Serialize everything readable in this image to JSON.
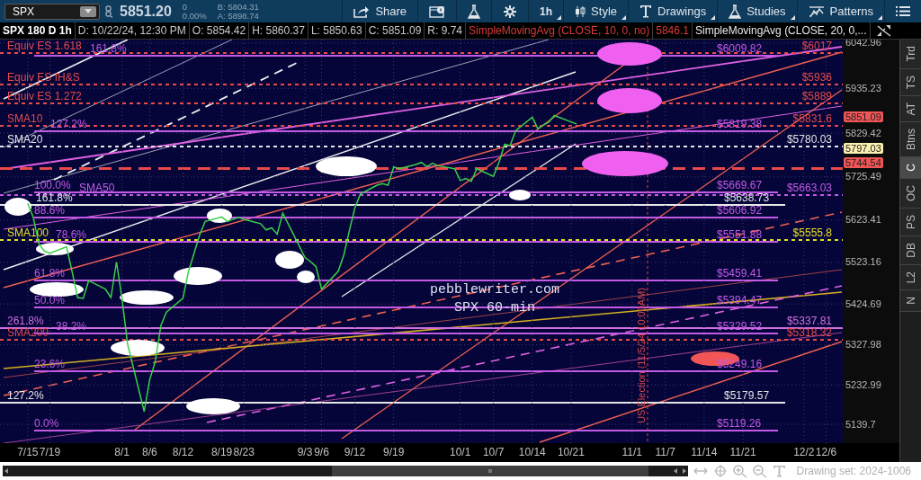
{
  "symbol_field": {
    "value": "SPX"
  },
  "quote": {
    "last": "5851.20",
    "change": "0",
    "change_pct": "0.00%",
    "bid": "B: 5804.31",
    "ask": "A: 5898.74"
  },
  "toolbar": [
    {
      "kind": "share",
      "label": "Share",
      "dropdown": false
    },
    {
      "kind": "info",
      "dropdown": false
    },
    {
      "kind": "flask",
      "dropdown": false
    },
    {
      "kind": "gear",
      "dropdown": false
    },
    {
      "kind": "text",
      "label": "1h",
      "dropdown": true
    },
    {
      "kind": "candles",
      "label": "Style",
      "dropdown": true
    },
    {
      "kind": "letter",
      "label": "Drawings",
      "dropdown": true
    },
    {
      "kind": "flask",
      "label": "Studies",
      "dropdown": true
    },
    {
      "kind": "pattern",
      "label": "Patterns",
      "dropdown": true
    },
    {
      "kind": "list",
      "dropdown": false
    }
  ],
  "info_bar": [
    {
      "kind": "plain",
      "text": "D: 10/22/24, 12:30 PM"
    },
    {
      "kind": "plain",
      "text": "O: 5854.42"
    },
    {
      "kind": "plain",
      "text": "H: 5860.37"
    },
    {
      "kind": "plain",
      "text": "L: 5850.63"
    },
    {
      "kind": "plain",
      "text": "C: 5851.09"
    },
    {
      "kind": "plain",
      "text": "R: 9.74"
    },
    {
      "kind": "study_red",
      "text": "SimpleMovingAvg (CLOSE, 10, 0, no)"
    },
    {
      "kind": "study_red",
      "text": "5846.1"
    },
    {
      "kind": "study",
      "text": "SimpleMovingAvg (CLOSE, 20, 0,..."
    }
  ],
  "chart": {
    "chart_data": {
      "type": "line",
      "grid": true,
      "x": [
        "2024-07-15",
        "2024-07-16",
        "2024-07-17",
        "2024-07-18",
        "2024-07-19",
        "2024-07-22",
        "2024-07-23",
        "2024-07-24",
        "2024-07-25",
        "2024-07-26",
        "2024-07-29",
        "2024-07-30",
        "2024-07-31",
        "2024-08-01",
        "2024-08-02",
        "2024-08-05",
        "2024-08-06",
        "2024-08-07",
        "2024-08-08",
        "2024-08-09",
        "2024-08-12",
        "2024-08-13",
        "2024-08-14",
        "2024-08-15",
        "2024-08-16",
        "2024-08-19",
        "2024-08-20",
        "2024-08-21",
        "2024-08-22",
        "2024-08-23",
        "2024-08-26",
        "2024-08-27",
        "2024-08-28",
        "2024-08-29",
        "2024-08-30",
        "2024-09-03",
        "2024-09-04",
        "2024-09-05",
        "2024-09-06",
        "2024-09-09",
        "2024-09-10",
        "2024-09-11",
        "2024-09-12",
        "2024-09-13",
        "2024-09-16",
        "2024-09-17",
        "2024-09-18",
        "2024-09-19",
        "2024-09-20",
        "2024-09-23",
        "2024-09-24",
        "2024-09-25",
        "2024-09-26",
        "2024-09-27",
        "2024-09-30",
        "2024-10-01",
        "2024-10-02",
        "2024-10-03",
        "2024-10-04",
        "2024-10-07",
        "2024-10-08",
        "2024-10-09",
        "2024-10-10",
        "2024-10-11",
        "2024-10-14",
        "2024-10-15",
        "2024-10-16",
        "2024-10-17",
        "2024-10-18",
        "2024-10-21",
        "2024-10-22"
      ],
      "series": [
        {
          "name": "SPX 180 D 1h",
          "color": "#3ad04a",
          "values": [
            5663,
            5630,
            5567,
            5550,
            5545,
            5560,
            5502,
            5440,
            5438,
            5480,
            5460,
            5440,
            5524,
            5438,
            5330,
            5170,
            5245,
            5288,
            5373,
            5405,
            5438,
            5502,
            5545,
            5588,
            5620,
            5631,
            5620,
            5625,
            5630,
            5625,
            5615,
            5600,
            5605,
            5590,
            5640,
            5535,
            5525,
            5513,
            5460,
            5502,
            5540,
            5598,
            5652,
            5685,
            5706,
            5710,
            5706,
            5749,
            5745,
            5755,
            5760,
            5750,
            5758,
            5752,
            5745,
            5717,
            5722,
            5715,
            5745,
            5727,
            5760,
            5803,
            5800,
            5835,
            5867,
            5840,
            5848,
            5856,
            5871,
            5856,
            5851
          ]
        }
      ],
      "xlim": [
        "2024-07-10",
        "2024-12-09"
      ],
      "ylim": [
        5095,
        6051
      ],
      "xticks": [
        {
          "value": "2024-07-15",
          "label": "7/15"
        },
        {
          "value": "2024-07-19",
          "label": "7/19"
        },
        {
          "value": "2024-08-01",
          "label": "8/1"
        },
        {
          "value": "2024-08-06",
          "label": "8/6"
        },
        {
          "value": "2024-08-12",
          "label": "8/12"
        },
        {
          "value": "2024-08-19",
          "label": "8/19"
        },
        {
          "value": "2024-08-23",
          "label": "8/23"
        },
        {
          "value": "2024-09-03",
          "label": "9/3"
        },
        {
          "value": "2024-09-06",
          "label": "9/6"
        },
        {
          "value": "2024-09-12",
          "label": "9/12"
        },
        {
          "value": "2024-09-19",
          "label": "9/19"
        },
        {
          "value": "2024-10-01",
          "label": "10/1"
        },
        {
          "value": "2024-10-07",
          "label": "10/7"
        },
        {
          "value": "2024-10-14",
          "label": "10/14"
        },
        {
          "value": "2024-10-21",
          "label": "10/21"
        },
        {
          "value": "2024-11-01",
          "label": "11/1"
        },
        {
          "value": "2024-11-07",
          "label": "11/7"
        },
        {
          "value": "2024-11-14",
          "label": "11/14"
        },
        {
          "value": "2024-11-21",
          "label": "11/21"
        },
        {
          "value": "2024-12-02",
          "label": "12/2"
        },
        {
          "value": "2024-12-06",
          "label": "12/6"
        }
      ],
      "yticks": [
        6042.96,
        5935.23,
        5829.42,
        5725.49,
        5623.41,
        5523.16,
        5424.69,
        5327.98,
        5232.99,
        5139.7
      ]
    }
  },
  "drawings": {
    "levels": [
      {
        "kind": "average",
        "name": "Equiv ES 1.618",
        "label": "$6017",
        "color": "#e84a4a"
      },
      {
        "kind": "fib",
        "name": "161.8%",
        "label": "$6009.82",
        "color": "#c25ae6"
      },
      {
        "kind": "average",
        "name": "Equiv ES IH&S",
        "label": "$5936",
        "color": "#e84a4a"
      },
      {
        "kind": "average",
        "name": "Equiv ES 1.272",
        "label": "$5889",
        "color": "#e84a4a"
      },
      {
        "kind": "average",
        "name": "SMA10",
        "label": "$5831.6",
        "color": "#e84a4a"
      },
      {
        "kind": "fib",
        "name": "127.2%",
        "label": "$5819.38",
        "color": "#c25ae6"
      },
      {
        "kind": "average",
        "name": "SMA20",
        "label": "$5780.03",
        "color": "#e6e6e6"
      },
      {
        "kind": "heavy",
        "color": "#e84a4a"
      },
      {
        "kind": "fib",
        "name": "100.0%",
        "label": "$5669.67",
        "color": "#c25ae6"
      },
      {
        "kind": "average",
        "name": "SMA50",
        "label": "$5663.03",
        "color": "#c25ae6"
      },
      {
        "kind": "extension",
        "name": "161.8%",
        "label": "$5638.73",
        "color": "#e6e6e6"
      },
      {
        "kind": "fib",
        "name": "88.6%",
        "label": "$5606.92",
        "color": "#c25ae6"
      },
      {
        "kind": "average",
        "name": "SMA100",
        "label": "$5555.8",
        "color": "#e6e020"
      },
      {
        "kind": "fib",
        "name": "78.6%",
        "label": "$5551.88",
        "color": "#c25ae6"
      },
      {
        "kind": "fib",
        "name": "61.8%",
        "label": "$5459.41",
        "color": "#c25ae6"
      },
      {
        "kind": "fib",
        "name": "50.0%",
        "label": "$5394.47",
        "color": "#c25ae6"
      },
      {
        "kind": "projection",
        "name": "261.8%",
        "label": "$5337.81",
        "color": "#d070e0"
      },
      {
        "kind": "fib",
        "name": "38.2%",
        "label": "$5329.52",
        "color": "#c25ae6"
      },
      {
        "kind": "average",
        "name": "SMA200",
        "label": "$5318.32",
        "color": "#e84a4a"
      },
      {
        "kind": "fib",
        "name": "23.6%",
        "label": "$5249.16",
        "color": "#c25ae6"
      },
      {
        "kind": "extension",
        "name": "127.2%",
        "label": "$5179.57",
        "color": "#e6e6e6"
      },
      {
        "kind": "fib",
        "name": "0.0%",
        "label": "$5119.26",
        "color": "#c25ae6"
      }
    ],
    "price_markers": [
      {
        "label": "5851.09",
        "color": "#f25555"
      },
      {
        "label": "5797.03",
        "color": "#fdf0b0"
      },
      {
        "label": "5744.54",
        "color": "#f25555"
      }
    ],
    "notes": [
      "pebblewriter.com",
      "SPX 60-min"
    ],
    "event_line": {
      "label": "US Election (11/5/24 10:00AM)"
    }
  },
  "side_tabs": [
    {
      "label": "Trd",
      "selected": false
    },
    {
      "label": "TS",
      "selected": false
    },
    {
      "label": "AT",
      "selected": false
    },
    {
      "label": "Btns",
      "selected": false
    },
    {
      "label": "C",
      "selected": true
    },
    {
      "label": "OC",
      "selected": false
    },
    {
      "label": "PS",
      "selected": false
    },
    {
      "label": "DB",
      "selected": false
    },
    {
      "label": "L2",
      "selected": false
    },
    {
      "label": "N",
      "selected": false
    }
  ],
  "drawing_set": "Drawing set: 2024-1006"
}
